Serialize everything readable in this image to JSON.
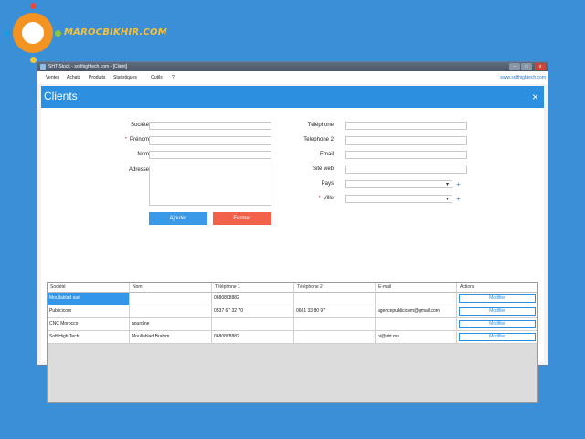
{
  "brand": {
    "site": "MAROCBIKHIR.COM"
  },
  "window": {
    "title": "SHT-Stock - softhightech.com - [Client]",
    "minimize": "–",
    "maximize": "□",
    "close": "x"
  },
  "menu": {
    "items": [
      "Ventes",
      "Achats",
      "Produits",
      "Statistiques",
      "Outils",
      "?"
    ],
    "link": "www.softhightech.com"
  },
  "dialog": {
    "title": "Clients",
    "close_glyph": "×"
  },
  "form": {
    "societe_label": "Société",
    "prenom_label": "Prénom",
    "nom_label": "Nom",
    "adresse_label": "Adresse",
    "telephone_label": "Téléphone",
    "telephone2_label": "Telephone 2",
    "email_label": "Email",
    "siteweb_label": "Site web",
    "pays_label": "Pays",
    "ville_label": "Ville",
    "required_mark": "*",
    "plus": "+",
    "ajouter": "Ajouter",
    "fermer": "Fermer"
  },
  "table": {
    "headers": [
      "Société",
      "Nom",
      "Téléphone 1",
      "Téléphone 2",
      "E-mail",
      "Actions"
    ],
    "rows": [
      [
        "Moullablad sarl",
        "",
        "0680808882",
        "",
        "",
        "Modifier"
      ],
      [
        "Publicicom",
        "",
        "0537 67 32 70",
        "0661 33 80 97",
        "agencepublicicom@gmail.com",
        "Modifier"
      ],
      [
        "CNC Morocco",
        "nourdine",
        "",
        "",
        "",
        "Modifier"
      ],
      [
        "Soft High Tech",
        "Moullablad Brahim",
        "0680808882",
        "",
        "hi@sht.ma",
        "Modifier"
      ]
    ]
  },
  "colors": {
    "background": "#3a8fd6",
    "accent": "#2d8fe0",
    "ajouter": "#3a9ae8",
    "fermer": "#f2624a",
    "selected_row": "#3396e8",
    "logo_orange": "#f39321",
    "logo_text": "#f7c23a"
  }
}
